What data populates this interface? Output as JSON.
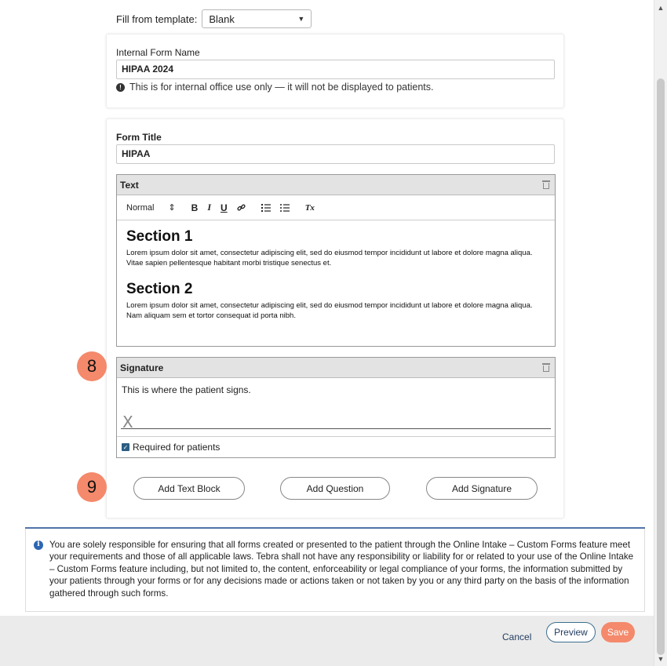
{
  "template": {
    "label": "Fill from template:",
    "selected": "Blank"
  },
  "internal_form": {
    "label": "Internal Form Name",
    "value": "HIPAA 2024",
    "hint": "This is for internal office use only — it will not be displayed to patients.",
    "hint_icon": "info-icon"
  },
  "form_title": {
    "label": "Form Title",
    "value": "HIPAA"
  },
  "text_block": {
    "header": "Text",
    "toolbar": {
      "style": "Normal",
      "style_arrows": "⇕",
      "bold": "B",
      "italic": "I",
      "underline": "U",
      "link_icon": "link-icon",
      "clear_format": "Tx"
    },
    "sections": [
      {
        "heading": "Section 1",
        "body": "Lorem ipsum dolor sit amet, consectetur adipiscing elit, sed do eiusmod tempor incididunt ut labore et dolore magna aliqua. Vitae sapien pellentesque habitant morbi tristique senectus et."
      },
      {
        "heading": "Section 2",
        "body": "Lorem ipsum dolor sit amet, consectetur adipiscing elit, sed do eiusmod tempor incididunt ut labore et dolore magna aliqua. Nam aliquam sem et tortor consequat id porta nibh."
      }
    ]
  },
  "signature_block": {
    "header": "Signature",
    "description": "This is where the patient signs.",
    "mark": "X",
    "required_label": "Required for patients",
    "required_checked": true
  },
  "add_buttons": {
    "text_block": "Add Text Block",
    "question": "Add Question",
    "signature": "Add Signature"
  },
  "callouts": {
    "signature": "8",
    "add_buttons": "9"
  },
  "disclaimer": "You are solely responsible for ensuring that all forms created or presented to the patient through the Online Intake – Custom Forms feature meet your requirements and those of all applicable laws. Tebra shall not have any responsibility or liability for or related to your use of the Online Intake – Custom Forms feature including, but not limited to, the content, enforceability or legal compliance of your forms, the information submitted by your patients through your forms or for any decisions made or actions taken or not taken by you or any third party on the basis of the information gathered through such forms.",
  "footer": {
    "cancel": "Cancel",
    "preview": "Preview",
    "save": "Save"
  },
  "colors": {
    "accent": "#f4896b",
    "info_blue": "#2d66b3",
    "checkbox": "#2b5d82",
    "rule": "#4f74a8"
  }
}
